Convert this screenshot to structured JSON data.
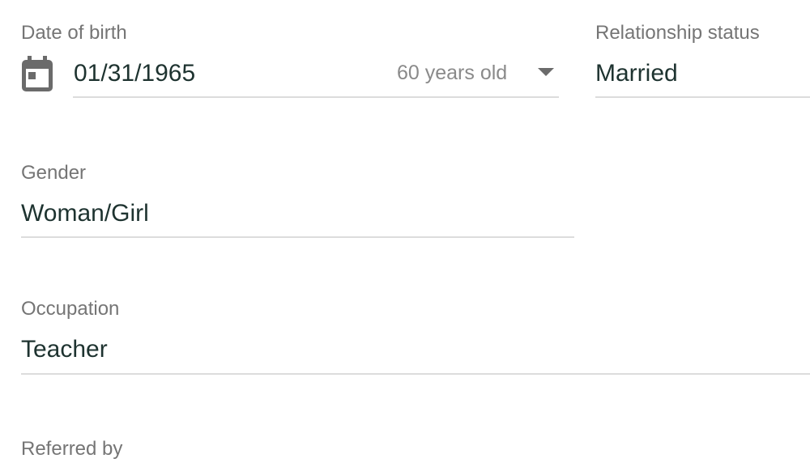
{
  "fields": {
    "date_of_birth": {
      "label": "Date of birth",
      "value": "01/31/1965",
      "age_text": "60 years old",
      "icon": "calendar-icon"
    },
    "relationship_status": {
      "label": "Relationship status",
      "value": "Married"
    },
    "gender": {
      "label": "Gender",
      "value": "Woman/Girl"
    },
    "occupation": {
      "label": "Occupation",
      "value": "Teacher"
    },
    "referred_by": {
      "label": "Referred by"
    }
  },
  "colors": {
    "label": "#757575",
    "value": "#1e3330",
    "underline": "#dcdcdc",
    "icon": "#6b6b6b"
  }
}
